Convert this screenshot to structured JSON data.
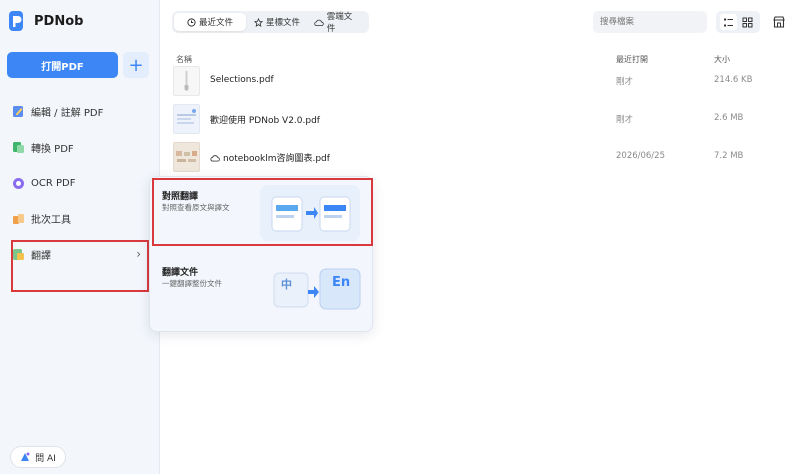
{
  "app": {
    "name": "PDNob"
  },
  "sidebar": {
    "open_button": "打開PDF",
    "plus_symbol": "+",
    "items": [
      {
        "label": "編輯 / 註解 PDF",
        "icon": "edit-pdf-icon"
      },
      {
        "label": "轉換 PDF",
        "icon": "convert-pdf-icon"
      },
      {
        "label": "OCR PDF",
        "icon": "ocr-icon"
      },
      {
        "label": "批次工具",
        "icon": "batch-tools-icon"
      },
      {
        "label": "翻譯",
        "icon": "translate-icon"
      }
    ],
    "chevron": "›",
    "ai_button": "問 AI"
  },
  "topbar": {
    "tabs": [
      {
        "label": "最近文件",
        "icon": "clock-icon",
        "active": true
      },
      {
        "label": "星標文件",
        "icon": "star-icon",
        "active": false
      },
      {
        "label": "雲端文件",
        "icon": "cloud-icon",
        "active": false
      }
    ],
    "search_placeholder": "搜尋檔案",
    "view": "list"
  },
  "table": {
    "headers": {
      "name": "名稱",
      "last_opened": "最近打開",
      "size": "大小"
    },
    "rows": [
      {
        "name": "Selections.pdf",
        "last_opened": "剛才",
        "size": "214.6 KB",
        "cloud": false
      },
      {
        "name": "歡迎使用 PDNob V2.0.pdf",
        "last_opened": "剛才",
        "size": "2.6 MB",
        "cloud": false
      },
      {
        "name": "notebooklm咨詢圖表.pdf",
        "last_opened": "2026/06/25",
        "size": "7.2 MB",
        "cloud": true
      }
    ]
  },
  "translate_menu": {
    "items": [
      {
        "title": "對照翻譯",
        "description": "對照查看原文與譯文"
      },
      {
        "title": "翻譯文件",
        "description": "一鍵翻譯整份文件",
        "badge_from": "中",
        "badge_to": "En"
      }
    ]
  },
  "colors": {
    "accent": "#3c86f5",
    "highlight": "#d9393c"
  }
}
